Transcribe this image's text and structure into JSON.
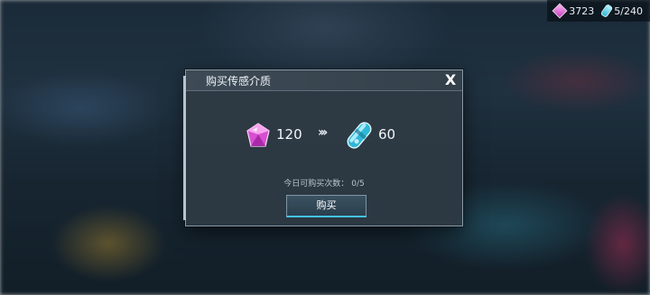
{
  "hud": {
    "gem_count": "3723",
    "vial_count": "5/240"
  },
  "dialog": {
    "title": "购买传感介质",
    "close_label": "X",
    "cost_amount": "120",
    "arrow": "›››",
    "gain_amount": "60",
    "limit_label": "今日可购买次数：",
    "limit_value": "0/5",
    "buy_label": "购买"
  },
  "colors": {
    "gem": "#c23cc0",
    "vial": "#2fb7d8",
    "button_accent": "#42c3e8"
  },
  "icons": {
    "cost": "pink-gem-icon",
    "gain": "cyan-vial-icon"
  }
}
